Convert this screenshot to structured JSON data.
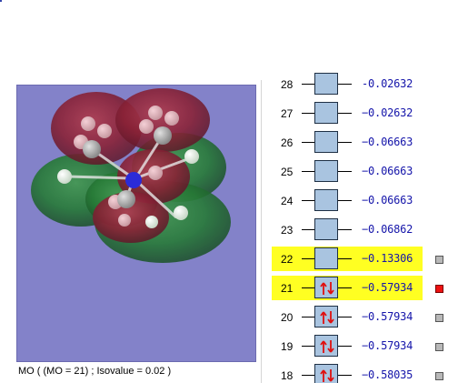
{
  "viewer": {
    "caption": "MO ( (MO = 21) ; Isovalue = 0.02 )"
  },
  "levels": [
    {
      "num": "28",
      "energy": "-0.02632",
      "occupied": false,
      "highlight": false,
      "marker": "none"
    },
    {
      "num": "27",
      "energy": "−0.02632",
      "occupied": false,
      "highlight": false,
      "marker": "none"
    },
    {
      "num": "26",
      "energy": "−0.06663",
      "occupied": false,
      "highlight": false,
      "marker": "none"
    },
    {
      "num": "25",
      "energy": "−0.06663",
      "occupied": false,
      "highlight": false,
      "marker": "none"
    },
    {
      "num": "24",
      "energy": "−0.06663",
      "occupied": false,
      "highlight": false,
      "marker": "none"
    },
    {
      "num": "23",
      "energy": "−0.06862",
      "occupied": false,
      "highlight": false,
      "marker": "none"
    },
    {
      "num": "22",
      "energy": "−0.13306",
      "occupied": false,
      "highlight": true,
      "marker": "gray"
    },
    {
      "num": "21",
      "energy": "−0.57934",
      "occupied": true,
      "highlight": true,
      "marker": "red"
    },
    {
      "num": "20",
      "energy": "−0.57934",
      "occupied": true,
      "highlight": false,
      "marker": "gray"
    },
    {
      "num": "19",
      "energy": "−0.57934",
      "occupied": true,
      "highlight": false,
      "marker": "gray"
    },
    {
      "num": "18",
      "energy": "−0.58035",
      "occupied": true,
      "highlight": false,
      "marker": "gray"
    }
  ],
  "colors": {
    "viewport_bg": "#8382c9",
    "highlight": "#ffff22",
    "level_box": "#a9c4e0",
    "energy_text": "#1515aa",
    "selected_marker": "#ee1111",
    "marker": "#b8b8b8",
    "lobe_positive": "#8b1a2a",
    "lobe_negative": "#1f7a2a"
  }
}
